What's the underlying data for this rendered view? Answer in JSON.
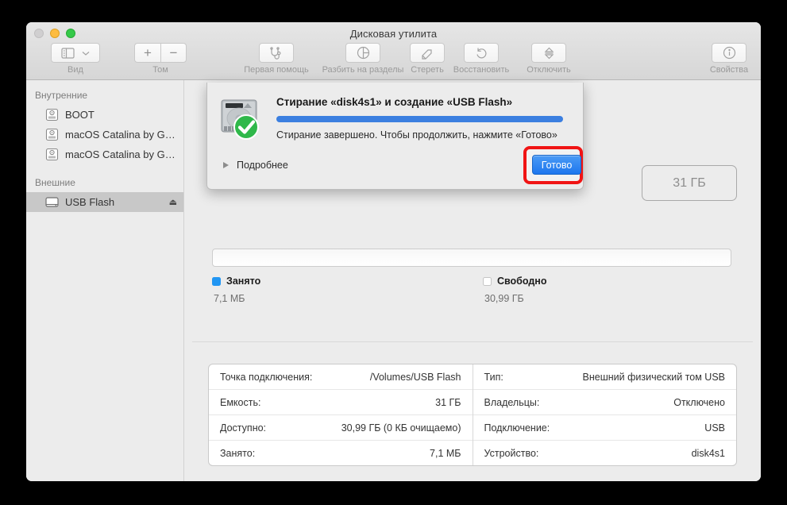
{
  "window": {
    "title": "Дисковая утилита",
    "traffic_lights": [
      "close",
      "minimize",
      "zoom"
    ]
  },
  "toolbar": {
    "items": [
      {
        "name": "view",
        "label": "Вид",
        "icon": "sidebar-icon",
        "enabled": true
      },
      {
        "name": "volume",
        "label": "Том",
        "icon": "plus-minus-icon",
        "enabled": true
      },
      {
        "name": "first-aid",
        "label": "Первая помощь",
        "icon": "stethoscope-icon",
        "enabled": false
      },
      {
        "name": "partition",
        "label": "Разбить на разделы",
        "icon": "pie-chart-icon",
        "enabled": false
      },
      {
        "name": "erase",
        "label": "Стереть",
        "icon": "erase-icon",
        "enabled": false
      },
      {
        "name": "restore",
        "label": "Восстановить",
        "icon": "undo-icon",
        "enabled": false
      },
      {
        "name": "unmount",
        "label": "Отключить",
        "icon": "eject-stack-icon",
        "enabled": false
      },
      {
        "name": "info",
        "label": "Свойства",
        "icon": "info-icon",
        "enabled": true
      }
    ]
  },
  "sidebar": {
    "groups": [
      {
        "header": "Внутренние",
        "items": [
          {
            "label": "BOOT",
            "icon": "internal-disk-icon",
            "selected": false,
            "eject": false
          },
          {
            "label": "macOS Catalina by Ge…",
            "icon": "internal-disk-icon",
            "selected": false,
            "eject": false
          },
          {
            "label": "macOS Catalina by Ge…",
            "icon": "internal-disk-icon",
            "selected": false,
            "eject": false
          }
        ]
      },
      {
        "header": "Внешние",
        "items": [
          {
            "label": "USB Flash",
            "icon": "external-drive-icon",
            "selected": true,
            "eject": true,
            "eject_glyph": "⏏"
          }
        ]
      }
    ]
  },
  "main": {
    "capacity_badge": "31 ГБ",
    "legend": [
      {
        "name": "Занято",
        "value": "7,1 МБ",
        "color": "#2196f3",
        "swatch": "used"
      },
      {
        "name": "Свободно",
        "value": "30,99 ГБ",
        "color": "#ffffff",
        "swatch": "free"
      }
    ],
    "info_table": {
      "left": [
        {
          "key": "Точка подключения:",
          "value": "/Volumes/USB Flash"
        },
        {
          "key": "Емкость:",
          "value": "31 ГБ"
        },
        {
          "key": "Доступно:",
          "value": "30,99 ГБ (0 КБ очищаемо)"
        },
        {
          "key": "Занято:",
          "value": "7,1 МБ"
        }
      ],
      "right": [
        {
          "key": "Тип:",
          "value": "Внешний физический том USB"
        },
        {
          "key": "Владельцы:",
          "value": "Отключено"
        },
        {
          "key": "Подключение:",
          "value": "USB"
        },
        {
          "key": "Устройство:",
          "value": "disk4s1"
        }
      ]
    }
  },
  "sheet": {
    "title": "Стирание «disk4s1» и создание «USB Flash»",
    "message": "Стирание завершено. Чтобы продолжить, нажмите «Готово»",
    "disclosure_label": "Подробнее",
    "progress_percent": 100,
    "progress_color": "#3b7fe0",
    "done_button": "Готово",
    "icon": "hard-drive-success-icon",
    "highlight_color": "#f01414"
  }
}
